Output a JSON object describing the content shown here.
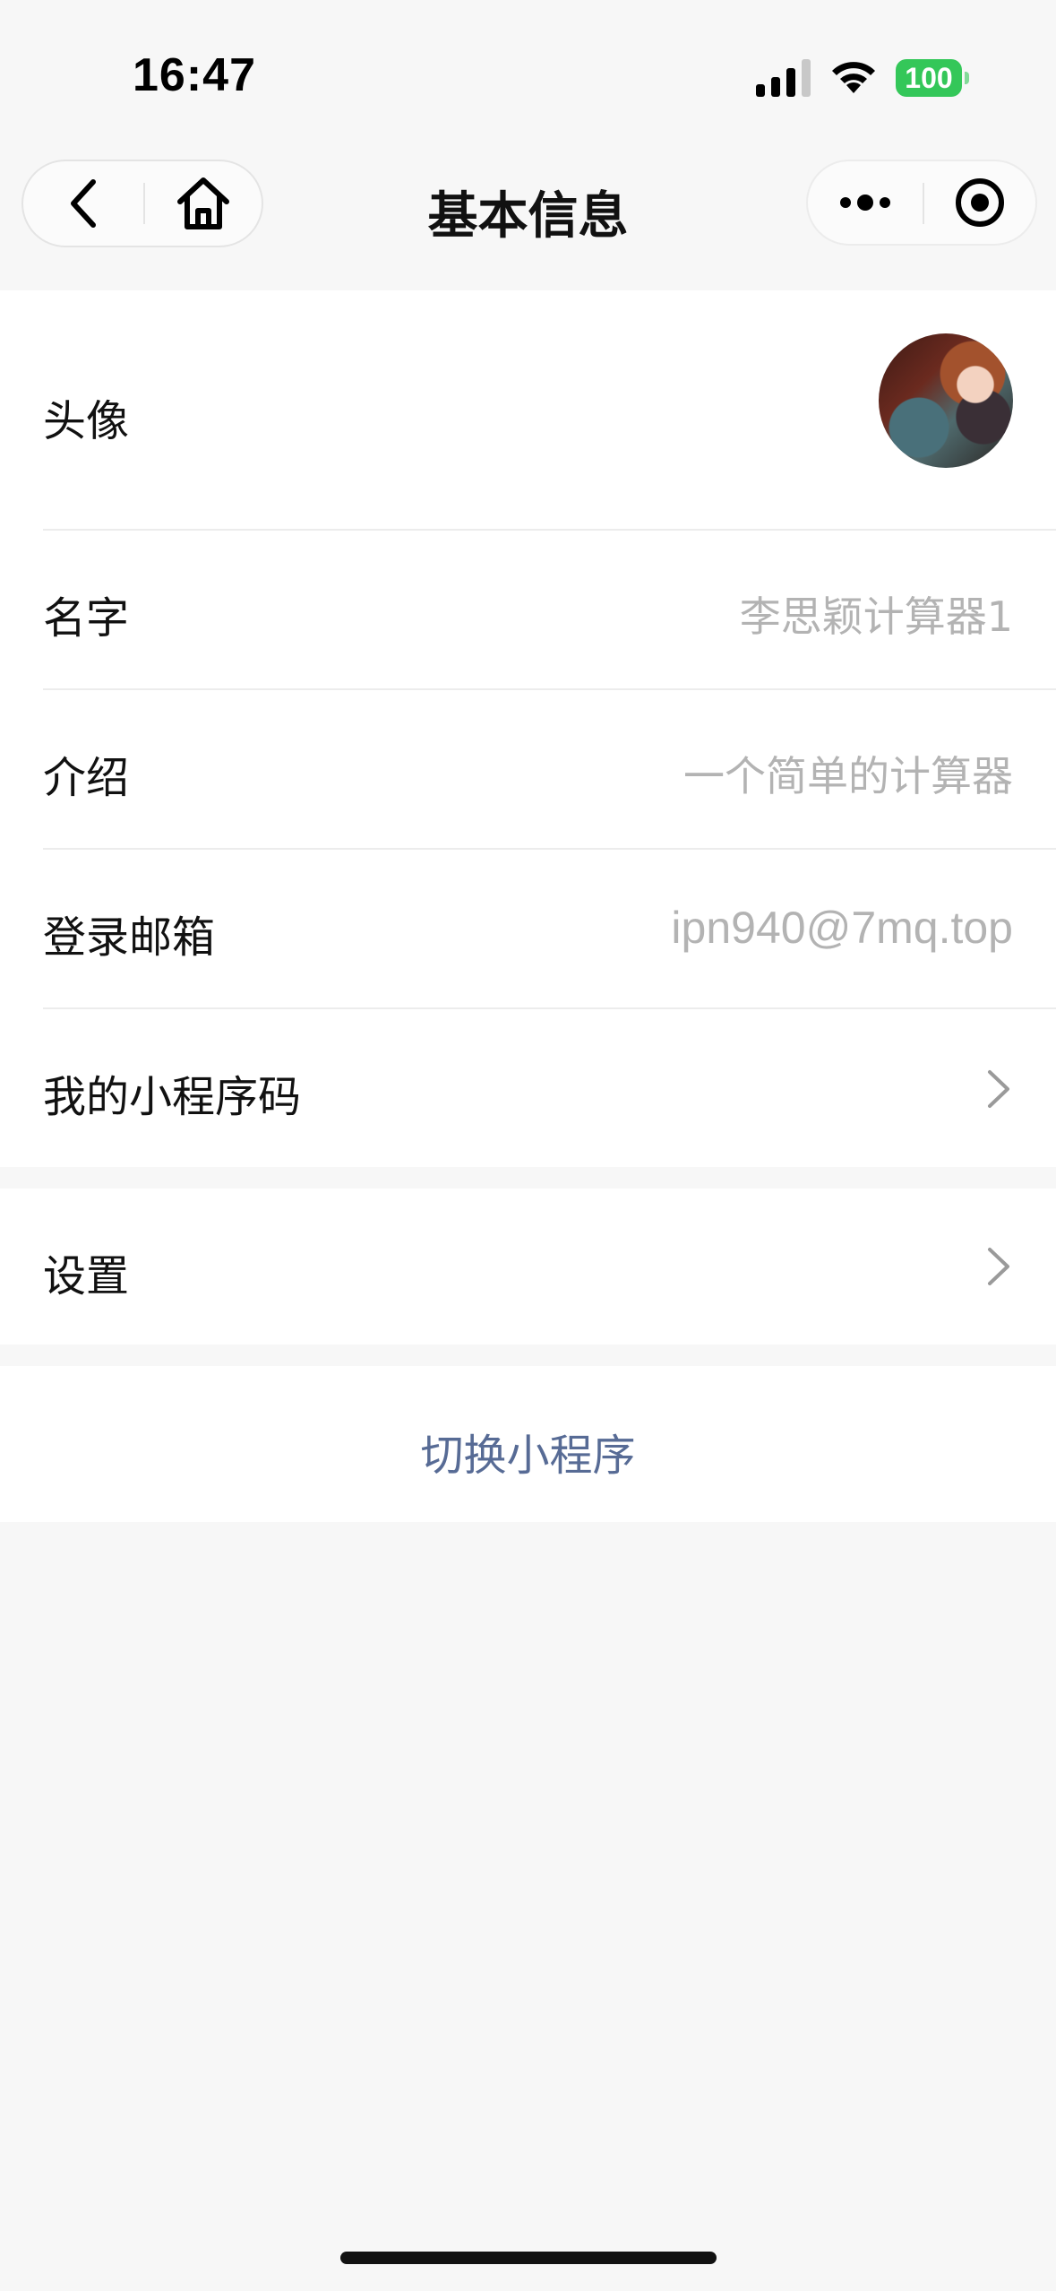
{
  "status_bar": {
    "time": "16:47",
    "battery": "100",
    "signal_icon": "cellular-signal-icon",
    "wifi_icon": "wifi-icon",
    "battery_color": "#34c759"
  },
  "nav": {
    "title": "基本信息",
    "back_icon": "chevron-left-icon",
    "home_icon": "home-icon",
    "more_icon": "more-dots-icon",
    "close_icon": "target-circle-icon"
  },
  "info": {
    "avatar_label": "头像",
    "name_label": "名字",
    "name_value": "李思颖计算器1",
    "intro_label": "介绍",
    "intro_value": "一个简单的计算器",
    "email_label": "登录邮箱",
    "email_value": "ipn940@7mq.top",
    "qrcode_label": "我的小程序码"
  },
  "settings": {
    "label": "设置"
  },
  "switch": {
    "label": "切换小程序",
    "color": "#576b95"
  }
}
